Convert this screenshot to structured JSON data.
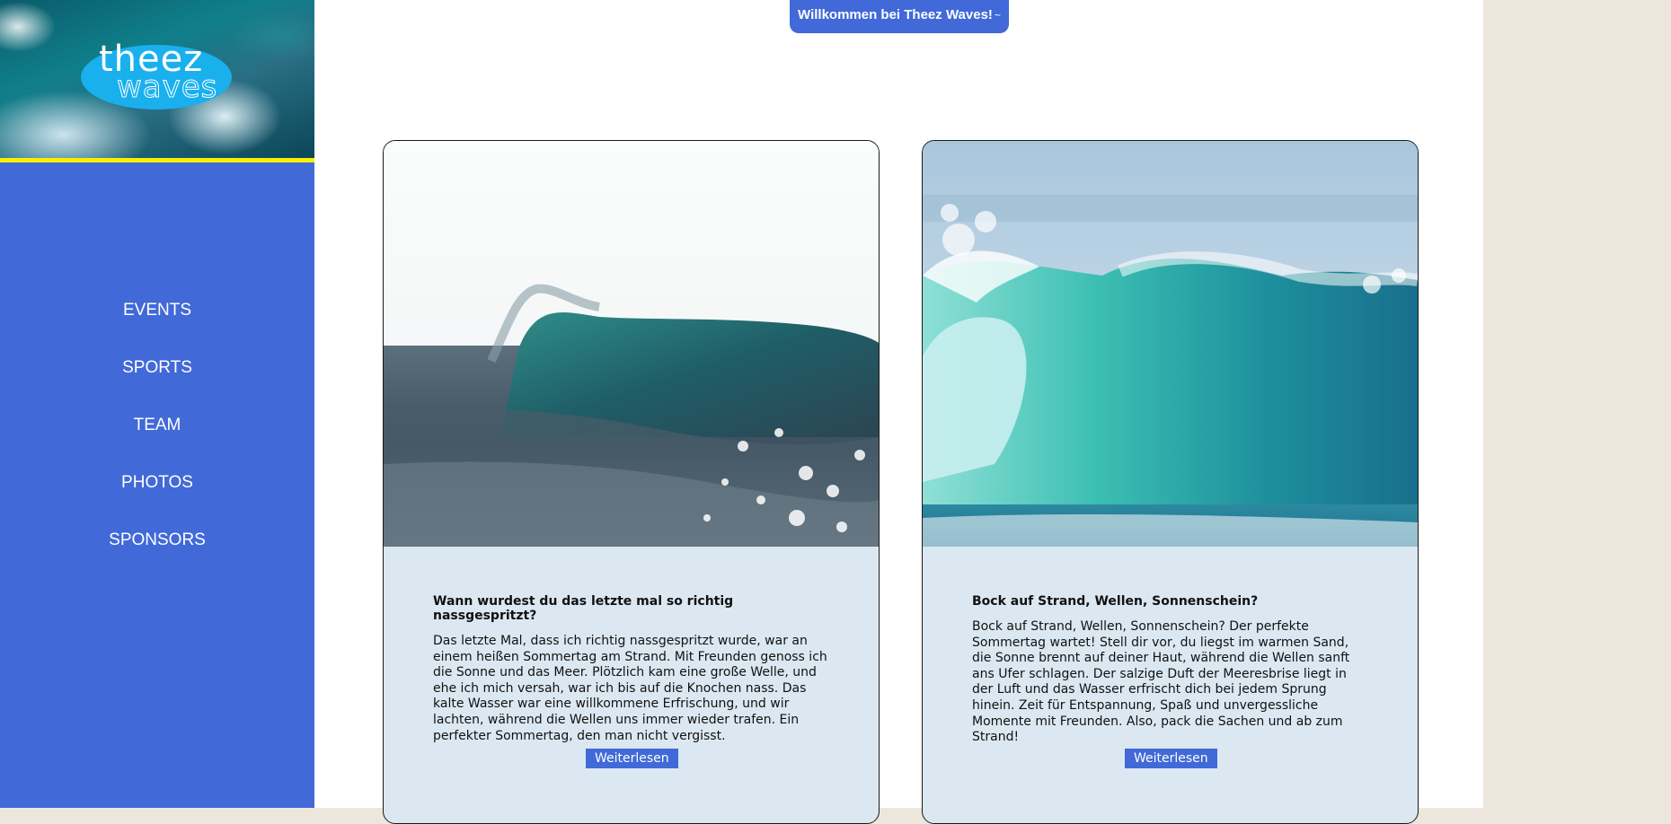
{
  "logo": {
    "word1": "theez",
    "word2": "waves"
  },
  "nav": {
    "items": [
      {
        "label": "EVENTS"
      },
      {
        "label": "SPORTS"
      },
      {
        "label": "TEAM"
      },
      {
        "label": "PHOTOS"
      },
      {
        "label": "SPONSORS"
      }
    ]
  },
  "banner": {
    "text": "Willkommen bei Theez Waves!",
    "icon": "wave-icon"
  },
  "cards": [
    {
      "title": "Wann wurdest du das letzte mal so richtig nassgespritzt?",
      "text": "Das letzte Mal, dass ich richtig nassgespritzt wurde, war an einem heißen Sommertag am Strand. Mit Freunden genoss ich die Sonne und das Meer. Plötzlich kam eine große Welle, und ehe ich mich versah, war ich bis auf die Knochen nass. Das kalte Wasser war eine willkommene Erfrischung, und wir lachten, während die Wellen uns immer wieder trafen. Ein perfekter Sommertag, den man nicht vergisst.",
      "button": "Weiterlesen",
      "image": "dark-ocean-wave-photo"
    },
    {
      "title": "Bock auf Strand, Wellen, Sonnenschein?",
      "text": "Bock auf Strand, Wellen, Sonnenschein? Der perfekte Sommertag wartet! Stell dir vor, du liegst im warmen Sand, die Sonne brennt auf deiner Haut, während die Wellen sanft ans Ufer schlagen. Der salzige Duft der Meeresbrise liegt in der Luft und das Wasser erfrischt dich bei jedem Sprung hinein. Zeit für Entspannung, Spaß und unvergessliche Momente mit Freunden. Also, pack die Sachen und ab zum Strand!",
      "button": "Weiterlesen",
      "image": "turquoise-barrel-wave-photo"
    }
  ],
  "colors": {
    "sidebar": "#4169d8",
    "accent_bar": "#f6f000",
    "card_body": "#dce8f1",
    "page_right": "#ede6dc",
    "logo_badge": "#1ab0ee"
  }
}
